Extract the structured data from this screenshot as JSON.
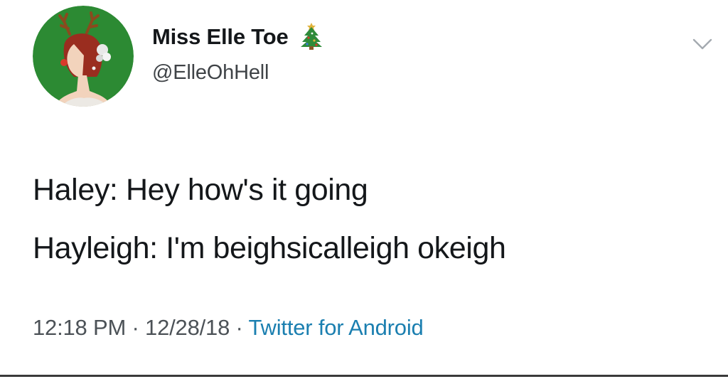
{
  "tweet": {
    "author": {
      "display_name": "Miss Elle Toe",
      "handle": "@ElleOhHell",
      "avatar_icon": "reindeer-woman-avatar",
      "name_emoji_icon": "christmas-tree-icon"
    },
    "menu_icon": "chevron-down-icon",
    "text_lines": [
      "Haley: Hey how's it going",
      "Hayleigh: I'm beighsicalleigh okeigh"
    ],
    "meta": {
      "time": "12:18 PM",
      "separator": " · ",
      "date": "12/28/18",
      "source": "Twitter for Android"
    }
  },
  "colors": {
    "text": "#14171a",
    "secondary_text": "#4c5257",
    "link": "#1b7fb0",
    "avatar_background": "#2c8a33"
  }
}
